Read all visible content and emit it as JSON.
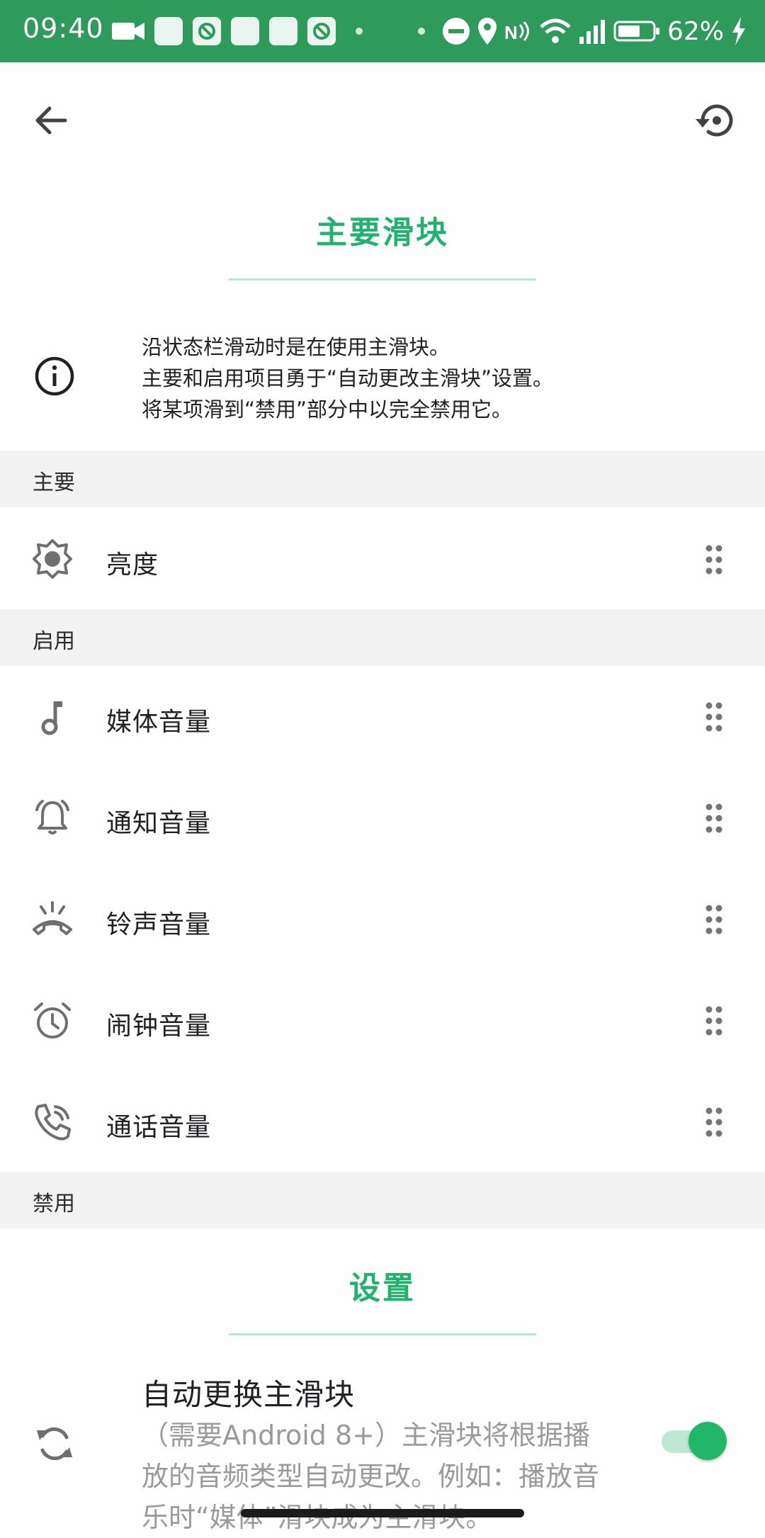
{
  "status_bar": {
    "time": "09:40",
    "battery_percent": "62%"
  },
  "header": {
    "back_icon": "arrow-left-icon",
    "restore_icon": "restore-icon"
  },
  "main_slider": {
    "title": "主要滑块",
    "info_lines": [
      "沿状态栏滑动时是在使用主滑块。",
      "主要和启用项目勇于“自动更改主滑块”设置。",
      "将某项滑到“禁用”部分中以完全禁用它。"
    ]
  },
  "groups": {
    "primary": {
      "header": "主要",
      "items": [
        {
          "label": "亮度",
          "icon": "brightness-icon"
        }
      ]
    },
    "enabled": {
      "header": "启用",
      "items": [
        {
          "label": "媒体音量",
          "icon": "music-note-icon"
        },
        {
          "label": "通知音量",
          "icon": "notification-bell-icon"
        },
        {
          "label": "铃声音量",
          "icon": "ringer-icon"
        },
        {
          "label": "闹钟音量",
          "icon": "alarm-clock-icon"
        },
        {
          "label": "通话音量",
          "icon": "phone-call-icon"
        }
      ]
    },
    "disabled": {
      "header": "禁用"
    }
  },
  "settings": {
    "title": "设置",
    "auto_switch": {
      "title": "自动更换主滑块",
      "description": "（需要Android 8+）主滑块将根据播放的音频类型自动更改。例如：播放音乐时“媒体”滑块成为主滑块。",
      "enabled": true
    }
  },
  "colors": {
    "status_bar": "#2e9b5b",
    "accent": "#21b26e",
    "toggle_on": "#20b768"
  }
}
